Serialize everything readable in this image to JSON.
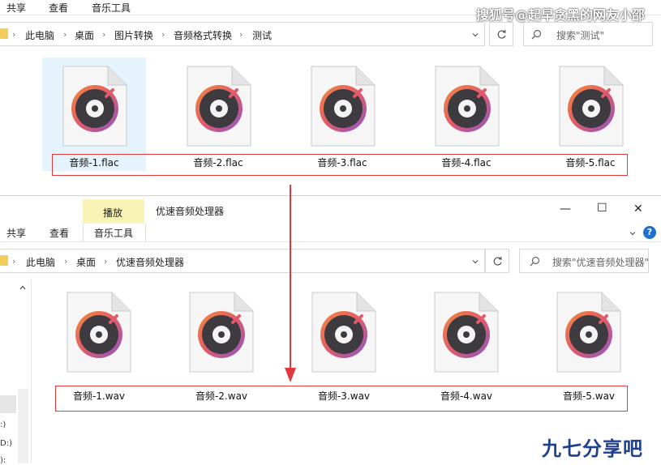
{
  "watermark_top": "搜狐号@起早贪黑的网友小邵",
  "watermark_bottom": "九七分享吧",
  "top_window": {
    "tabs": [
      "共享",
      "查看",
      "音乐工具"
    ],
    "breadcrumb": [
      "此电脑",
      "桌面",
      "图片转换",
      "音频格式转换",
      "测试"
    ],
    "search_placeholder": "搜索\"测试\"",
    "files": [
      "音频-1.flac",
      "音频-2.flac",
      "音频-3.flac",
      "音频-4.flac",
      "音频-5.flac"
    ]
  },
  "bottom_window": {
    "context_tab": "播放",
    "title": "优速音频处理器",
    "tabs": [
      "共享",
      "查看",
      "音乐工具"
    ],
    "breadcrumb": [
      "此电脑",
      "桌面",
      "优速音频处理器"
    ],
    "search_placeholder": "搜索\"优速音频处理器\"",
    "files": [
      "音频-1.wav",
      "音频-2.wav",
      "音频-3.wav",
      "音频-4.wav",
      "音频-5.wav"
    ],
    "drives": [
      ":)",
      "D:)",
      "):"
    ],
    "help": "?"
  },
  "controls": {
    "minimize": "—",
    "maximize": "☐",
    "close": "✕"
  },
  "colors": {
    "accent": "#e0383c",
    "context_tab": "#f9f4b6",
    "selection": "#e5f3fd"
  }
}
